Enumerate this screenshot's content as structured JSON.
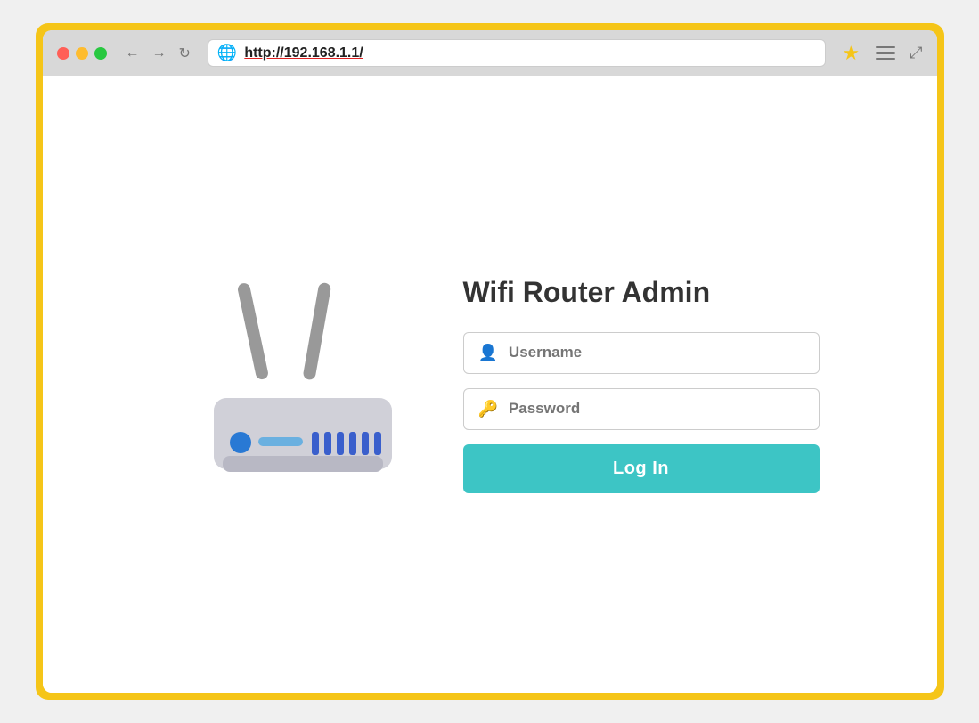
{
  "browser": {
    "url": "http://192.168.1.1/",
    "nav": {
      "back_label": "←",
      "forward_label": "→",
      "reload_label": "↻"
    },
    "fullscreen_label": "⤢"
  },
  "page": {
    "title": "Wifi Router Admin",
    "username_placeholder": "Username",
    "password_placeholder": "Password",
    "login_button_label": "Log In"
  },
  "icons": {
    "globe": "🌐",
    "star": "★",
    "person": "👤",
    "key": "🔑"
  },
  "colors": {
    "border": "#f5c518",
    "login_btn": "#3dc5c5",
    "router_body": "#d0d0d8",
    "antenna": "#999999",
    "led_blue": "#2979d4",
    "led_bar": "#6ab0e0",
    "port_bars": "#3a5fcc"
  }
}
